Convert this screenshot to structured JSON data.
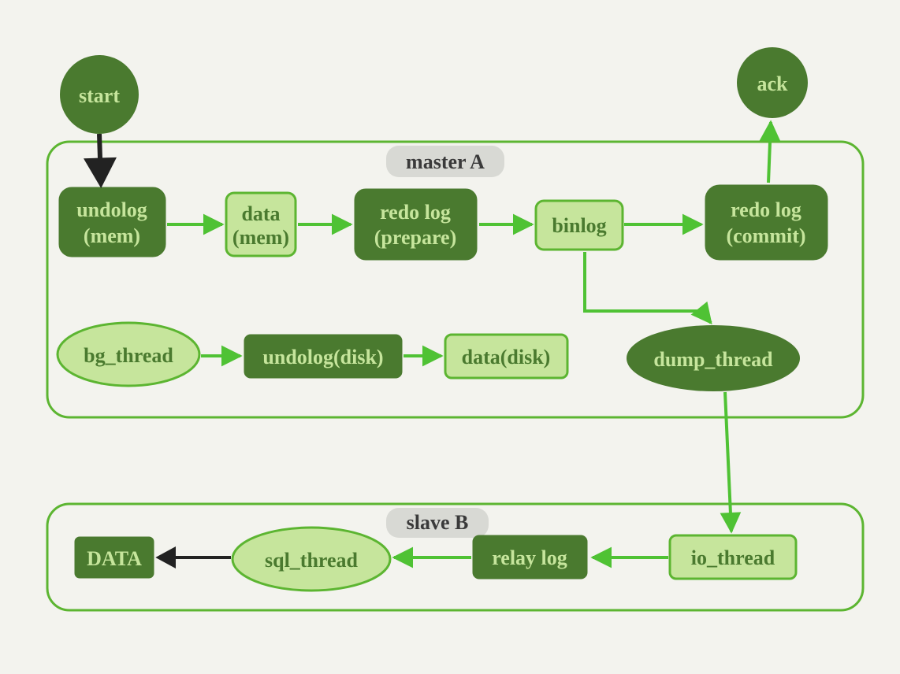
{
  "diagram": {
    "title_master": "master A",
    "title_slave": "slave B",
    "nodes": {
      "start": "start",
      "ack": "ack",
      "undolog_mem1": "undolog",
      "undolog_mem2": "(mem)",
      "data_mem1": "data",
      "data_mem2": "(mem)",
      "redo_prep1": "redo log",
      "redo_prep2": "(prepare)",
      "binlog": "binlog",
      "redo_commit1": "redo log",
      "redo_commit2": "(commit)",
      "bg_thread": "bg_thread",
      "undolog_disk": "undolog(disk)",
      "data_disk": "data(disk)",
      "dump_thread": "dump_thread",
      "io_thread": "io_thread",
      "relay_log": "relay log",
      "sql_thread": "sql_thread",
      "data_final": "DATA"
    }
  }
}
